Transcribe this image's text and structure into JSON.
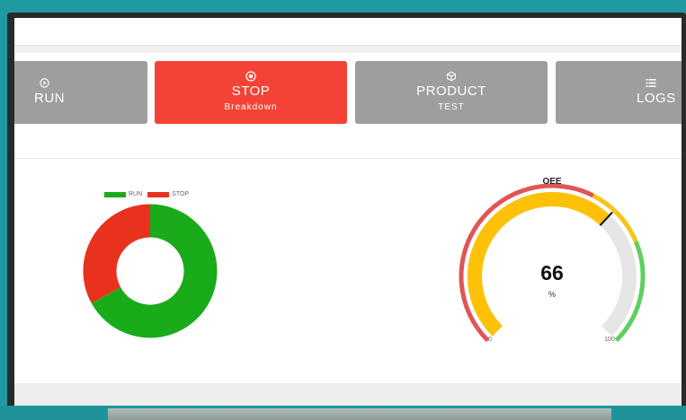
{
  "buttons": {
    "run": {
      "label": "RUN",
      "icon": "play-circle-icon"
    },
    "stop": {
      "label": "STOP",
      "sub": "Breakdown",
      "icon": "stop-circle-icon",
      "color": "#f44336"
    },
    "product": {
      "label": "PRODUCT",
      "sub": "TEST",
      "icon": "cube-icon"
    },
    "logs": {
      "label": "LOGS",
      "icon": "list-icon"
    }
  },
  "chart_data": [
    {
      "type": "pie",
      "variant": "donut",
      "categories": [
        "RUN",
        "STOP"
      ],
      "values": [
        67,
        33
      ],
      "colors": [
        "#1aab1a",
        "#e8321e"
      ],
      "legend": "top"
    },
    {
      "type": "gauge",
      "title": "OEE",
      "value": 66,
      "unit": "%",
      "min": 0,
      "max": 100,
      "min_label": "0",
      "max_label": "100",
      "bands": [
        {
          "from": 0,
          "to": 60,
          "color": "#e05555"
        },
        {
          "from": 60,
          "to": 75,
          "color": "#f5c518"
        },
        {
          "from": 75,
          "to": 100,
          "color": "#5fd05f"
        }
      ],
      "fill_color": "#ffc107",
      "track_color": "#e6e6e6"
    }
  ]
}
